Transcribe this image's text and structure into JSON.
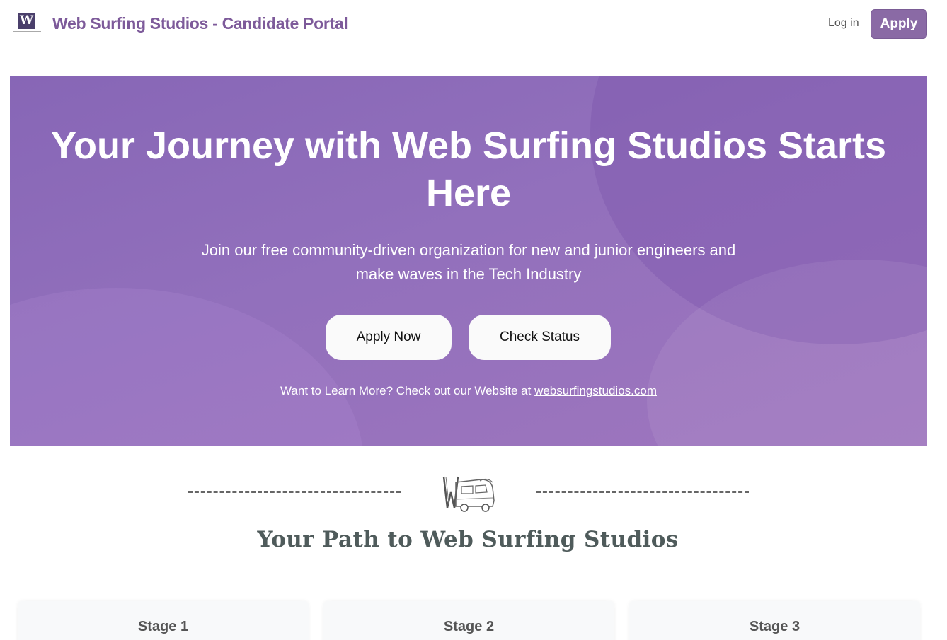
{
  "header": {
    "logo_icon": "ws-logo-icon",
    "title": "Web Surfing Studios - Candidate Portal",
    "login_label": "Log in",
    "apply_label": "Apply"
  },
  "hero": {
    "title": "Your Journey with Web Surfing Studios Starts Here",
    "subtitle": "Join our free community-driven organization for new and junior engineers and make waves in the Tech Industry",
    "apply_now_label": "Apply Now",
    "check_status_label": "Check Status",
    "learn_more_text": "Want to Learn More? Check out our Website at ",
    "website_link": "websurfingstudios.com"
  },
  "path": {
    "icon": "van-icon",
    "title": "Your Path to Web Surfing Studios"
  },
  "stages": [
    {
      "label": "Stage 1"
    },
    {
      "label": "Stage 2"
    },
    {
      "label": "Stage 3"
    }
  ],
  "colors": {
    "brand": "#7d5a9a",
    "hero_bg": "#9270bc",
    "apply_btn": "#8a6aa5"
  }
}
